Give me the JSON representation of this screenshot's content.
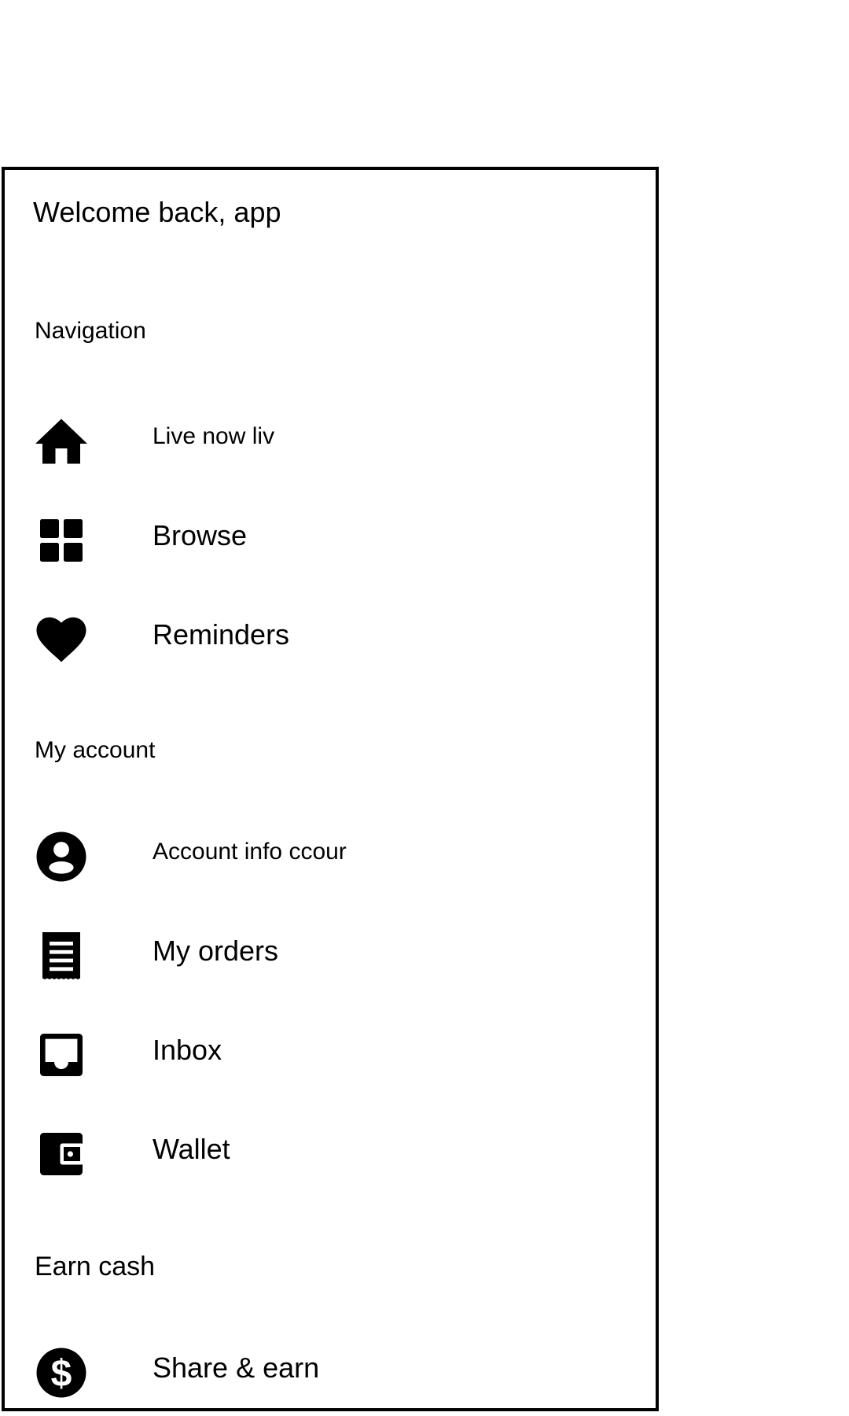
{
  "drawer": {
    "welcome_text": "Welcome back, app",
    "sections": {
      "navigation": {
        "title": "Navigation",
        "items": [
          {
            "label": "Live now liv",
            "icon": "home-icon"
          },
          {
            "label": "Browse",
            "icon": "grid-icon"
          },
          {
            "label": "Reminders",
            "icon": "heart-icon"
          }
        ]
      },
      "account": {
        "title": "My account",
        "items": [
          {
            "label": "Account info ccour",
            "icon": "account-circle-icon"
          },
          {
            "label": "My orders",
            "icon": "receipt-icon"
          },
          {
            "label": "Inbox",
            "icon": "inbox-icon"
          },
          {
            "label": "Wallet",
            "icon": "wallet-icon"
          }
        ]
      },
      "earn": {
        "title": "Earn cash",
        "items": [
          {
            "label": "Share & earn",
            "icon": "dollar-icon"
          }
        ]
      }
    }
  },
  "colors": {
    "background": "#ffffff",
    "text": "#000000",
    "border": "#000000"
  }
}
